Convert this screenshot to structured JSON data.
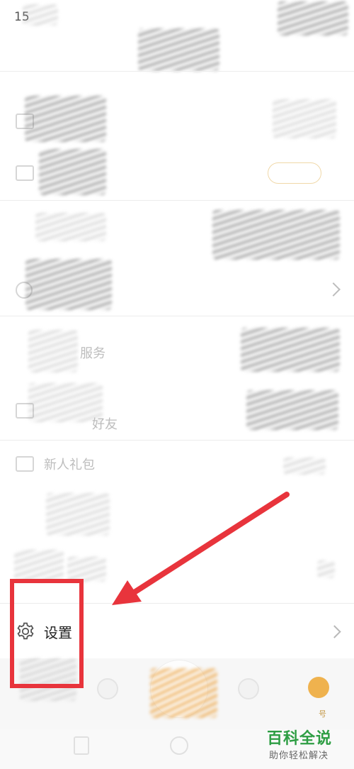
{
  "status_bar": {
    "time": "15"
  },
  "menu": {
    "service_label": "服务",
    "friends_label": "好友",
    "gift_label": "新人礼包",
    "settings_label": "设置"
  },
  "tabbar": {
    "account_label": "号"
  },
  "watermark": {
    "title": "百科全说",
    "subtitle": "助你轻松解决"
  },
  "colors": {
    "highlight_red": "#e8343c",
    "watermark_green": "#2e9e44",
    "accent_orange": "#eba03c"
  }
}
